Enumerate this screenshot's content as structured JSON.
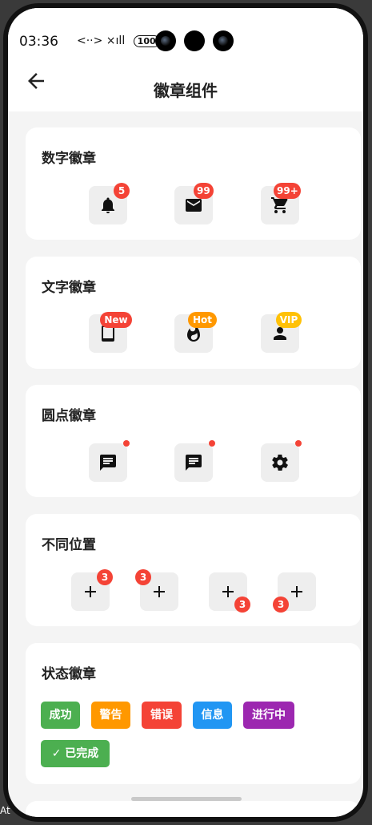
{
  "status": {
    "time": "03:36",
    "network": "<··> ×ıll",
    "battery": "100"
  },
  "appbar": {
    "title": "徽章组件"
  },
  "sections": {
    "numeric": {
      "title": "数字徽章",
      "badges": [
        "5",
        "99",
        "99+"
      ]
    },
    "text": {
      "title": "文字徽章",
      "badges": [
        "New",
        "Hot",
        "VIP"
      ]
    },
    "dot": {
      "title": "圆点徽章"
    },
    "position": {
      "title": "不同位置",
      "badges": [
        "3",
        "3",
        "3",
        "3"
      ]
    },
    "status": {
      "title": "状态徽章",
      "tags": [
        "成功",
        "警告",
        "错误",
        "信息",
        "进行中"
      ],
      "done": "✓ 已完成"
    }
  },
  "colors": {
    "badge_red": "#f44336",
    "badge_orange": "#ff9800",
    "badge_amber": "#ffc107",
    "success": "#4caf50",
    "warning": "#ff9800",
    "error": "#f44336",
    "info": "#2196f3",
    "progress": "#9c27b0"
  },
  "icons": [
    "back-arrow-icon",
    "bell-icon",
    "mail-icon",
    "cart-icon",
    "tablet-icon",
    "fire-icon",
    "person-icon",
    "message-icon",
    "gear-icon",
    "plus-icon"
  ],
  "footer": {
    "side_text": "At"
  }
}
